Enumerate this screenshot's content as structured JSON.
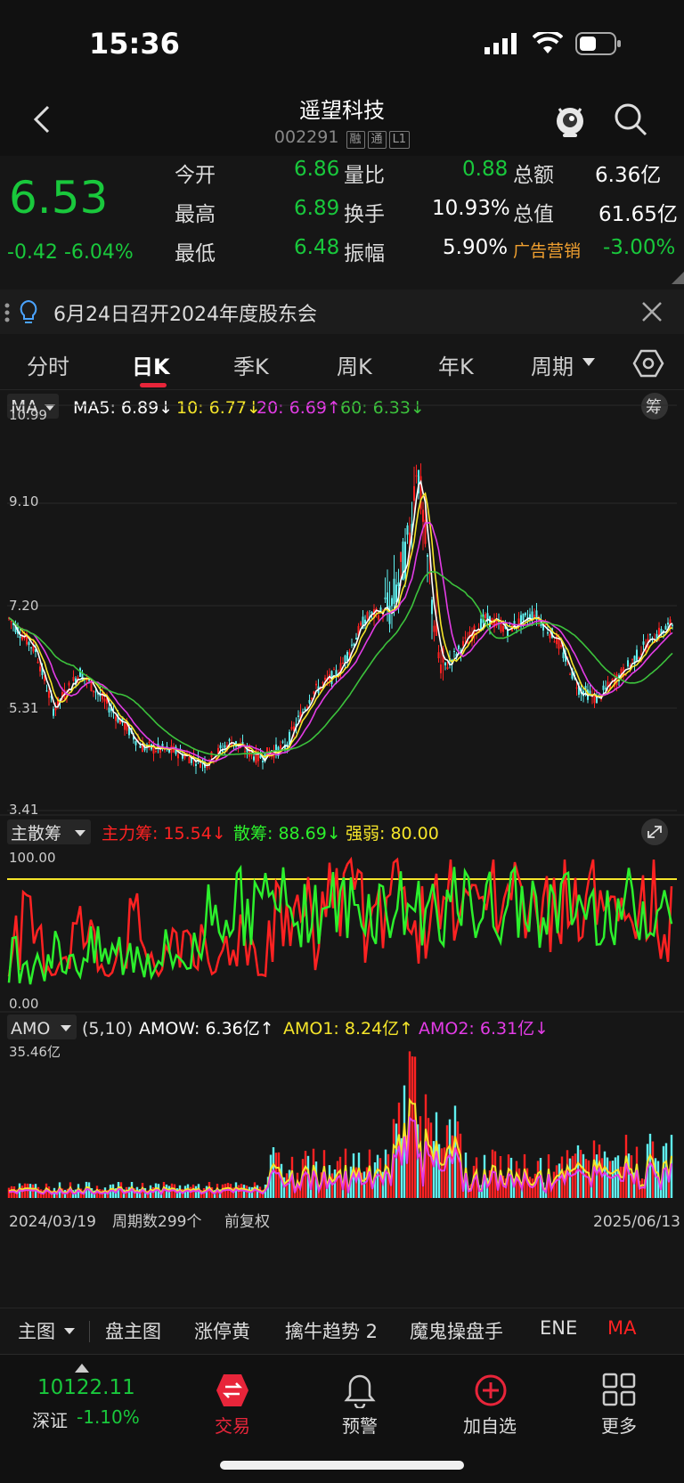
{
  "status_bar": {
    "time": "15:36"
  },
  "header": {
    "title": "遥望科技",
    "code": "002291",
    "tags": [
      "融",
      "通",
      "L1"
    ]
  },
  "quote": {
    "price": "6.53",
    "change": "-0.42",
    "change_pct": "-6.04%",
    "open_label": "今开",
    "open": "6.86",
    "volratio_label": "量比",
    "volratio": "0.88",
    "amount_label": "总额",
    "amount": "6.36亿",
    "high_label": "最高",
    "high": "6.89",
    "turnover_label": "换手",
    "turnover": "10.93%",
    "mktcap_label": "总值",
    "mktcap": "61.65亿",
    "low_label": "最低",
    "low": "6.48",
    "amplitude_label": "振幅",
    "amplitude": "5.90%",
    "sector_label": "广告营销",
    "sector_pct": "-3.00%"
  },
  "notice": {
    "text": "6月24日召开2024年度股东会"
  },
  "tabs": [
    "分时",
    "日K",
    "季K",
    "周K",
    "年K",
    "周期"
  ],
  "ma_legend": {
    "selector": "MA",
    "ma5": "MA5: 6.89↓",
    "ma10": "10: 6.77↓",
    "ma20": "20: 6.69↑",
    "ma60": "60: 6.33↓",
    "chip_btn": "筹"
  },
  "price_axis": [
    "10.99",
    "9.10",
    "7.20",
    "5.31",
    "3.41"
  ],
  "indicator1": {
    "selector": "主散筹",
    "main": "主力筹: 15.54↓",
    "retail": "散筹: 88.69↓",
    "strength": "强弱: 80.00",
    "axis_top": "100.00",
    "axis_bottom": "0.00"
  },
  "indicator2": {
    "selector": "AMO",
    "period": "(5,10)",
    "amow": "AMOW: 6.36亿↑",
    "amo1": "AMO1: 8.24亿↑",
    "amo2": "AMO2: 6.31亿↓",
    "axis_top": "35.46亿"
  },
  "date_bar": {
    "start": "2024/03/19",
    "periods": "周期数299个",
    "adjust": "前复权",
    "end": "2025/06/13"
  },
  "bottom_menu": [
    "主图",
    "盘主图",
    "涨停黄",
    "擒牛趋势 2",
    "魔鬼操盘手",
    "ENE",
    "MA"
  ],
  "dock": {
    "index_value": "10122.11",
    "index_name": "深证",
    "index_pct": "-1.10%",
    "trade": "交易",
    "alert": "预警",
    "add": "加自选",
    "more": "更多"
  },
  "colors": {
    "up": "#f22",
    "down": "#19c83c",
    "accent": "#e8253a"
  }
}
